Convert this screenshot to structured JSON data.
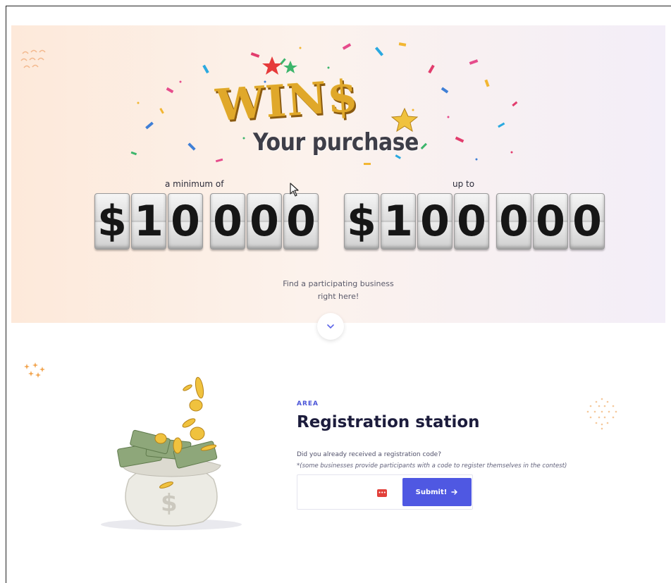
{
  "hero": {
    "logo_word": "WIN$",
    "tagline": "Your purchase",
    "min_label": "a minimum of",
    "max_label": "up to",
    "min_amount": [
      "$",
      "1",
      "0",
      "0",
      "0",
      "0"
    ],
    "max_amount": [
      "$",
      "1",
      "0",
      "0",
      "0",
      "0",
      "0"
    ],
    "find_line1": "Find a participating business",
    "find_line2": "right here!",
    "scroll_icon": "chevron-down-icon"
  },
  "registration": {
    "area_label": "AREA",
    "title": "Registration station",
    "question": "Did you already received a registration code?",
    "note": "*(some businesses provide participants with a code to register themselves in the contest)",
    "code_value": "",
    "submit_label": "Submit!",
    "submit_icon": "arrow-right-icon"
  },
  "colors": {
    "accent": "#4f58e2",
    "gold": "#e0a82a",
    "title": "#1c1c3c",
    "hero_left": "#fde9da",
    "hero_right": "#f3eef8"
  }
}
